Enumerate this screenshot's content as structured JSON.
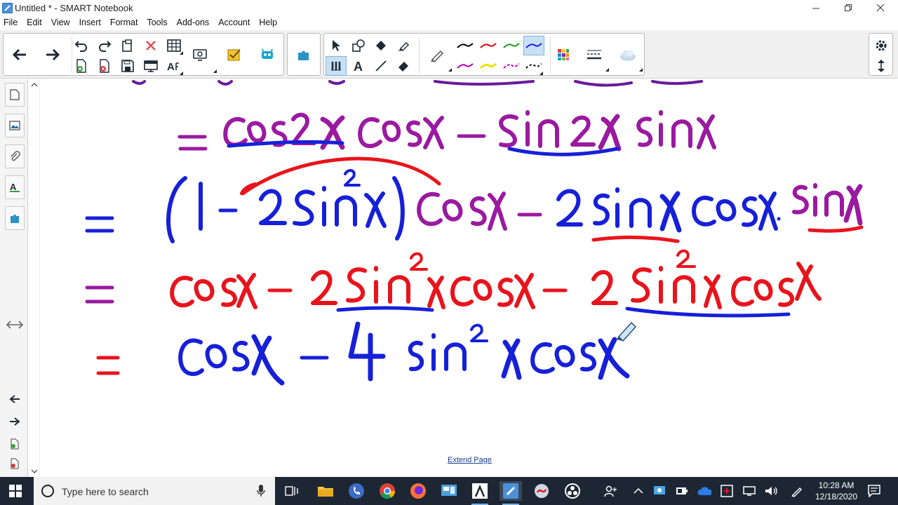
{
  "window": {
    "title": "Untitled * - SMART Notebook"
  },
  "menubar": {
    "items": [
      "File",
      "Edit",
      "View",
      "Insert",
      "Format",
      "Tools",
      "Add-ons",
      "Account",
      "Help"
    ]
  },
  "toolbar": {
    "icons": [
      "back-arrow-icon",
      "forward-arrow-icon",
      "undo-icon",
      "redo-icon",
      "paste-icon",
      "delete-icon",
      "table-icon",
      "new-page-icon",
      "delete-page-icon",
      "save-icon",
      "screen-shade-icon",
      "text-recognition-icon",
      "document-camera-icon",
      "response-icon",
      "activity-builder-icon",
      "add-ons-icon",
      "select-icon",
      "shapes-icon",
      "fill-icon",
      "eraser-icon",
      "pens-icon",
      "text-icon",
      "line-icon",
      "magic-pen-icon",
      "pen-style-icon",
      "color-palette-icon",
      "line-properties-icon",
      "pen-fill-icon",
      "settings-gear-icon",
      "toolbar-move-icon"
    ],
    "pen_colors": [
      "#000000",
      "#e00000",
      "#1a9c1a",
      "#1a1aee",
      "#b000b0",
      "#f2e000",
      "#cc00cc",
      "#000000"
    ]
  },
  "canvas": {
    "extend_link": "Extend Page",
    "ink_colors": {
      "purple": "#9a1aa0",
      "red": "#e8141c",
      "blue": "#1620d8"
    },
    "lines": [
      {
        "text": "= cos2x cosx − sin2x sinx"
      },
      {
        "text": "= (1 − 2sin²x) cosx − 2sinx cosx · sinx"
      },
      {
        "text": "= cosx − 2sin²x cosx − 2sin²x cosx"
      },
      {
        "text": "= cosx − 4sin²x cosx"
      }
    ]
  },
  "taskbar": {
    "search_placeholder": "Type here to search",
    "time": "10:28 AM",
    "date": "12/18/2020"
  }
}
